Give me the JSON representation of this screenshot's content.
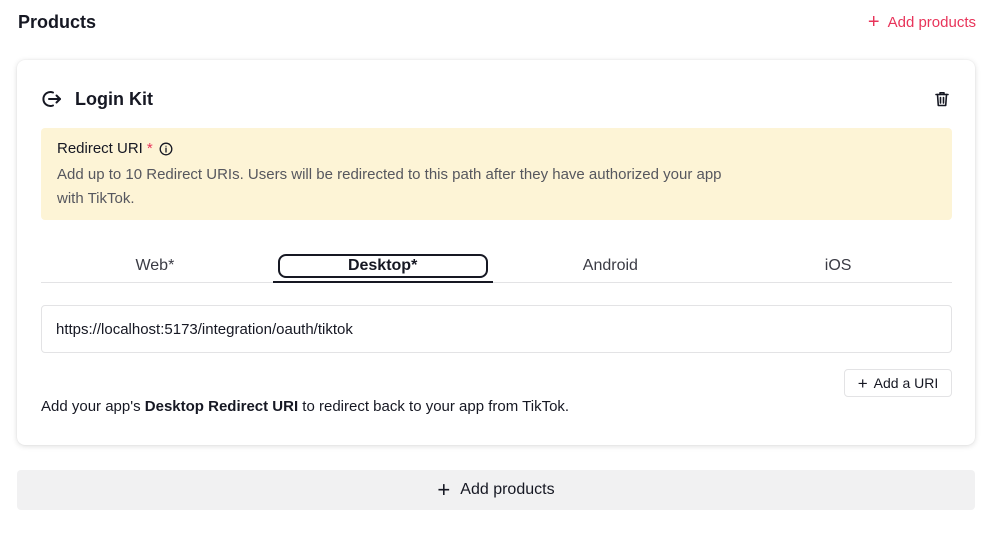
{
  "header": {
    "title": "Products",
    "add_label": "Add products",
    "add_icon": "plus-icon"
  },
  "card": {
    "title": "Login Kit",
    "title_icon": "login-arrow-icon",
    "delete_icon": "trash-icon",
    "notice": {
      "title": "Redirect URI",
      "required_mark": "*",
      "info_icon": "info-icon",
      "description": "Add up to 10 Redirect URIs. Users will be redirected to this path after they have authorized your app with TikTok."
    },
    "tabs": [
      {
        "label": "Web*",
        "active": false
      },
      {
        "label": "Desktop*",
        "active": true
      },
      {
        "label": "Android",
        "active": false
      },
      {
        "label": "iOS",
        "active": false
      }
    ],
    "uri_value": "https://localhost:5173/integration/oauth/tiktok",
    "add_uri_label": "Add a URI",
    "help": {
      "prefix": "Add your app's ",
      "bold": "Desktop Redirect URI",
      "suffix": " to redirect back to your app from TikTok."
    }
  },
  "bottom": {
    "add_label": "Add products"
  },
  "colors": {
    "accent": "#e8345a",
    "notice_bg": "#fdf4d6",
    "text": "#161823"
  }
}
